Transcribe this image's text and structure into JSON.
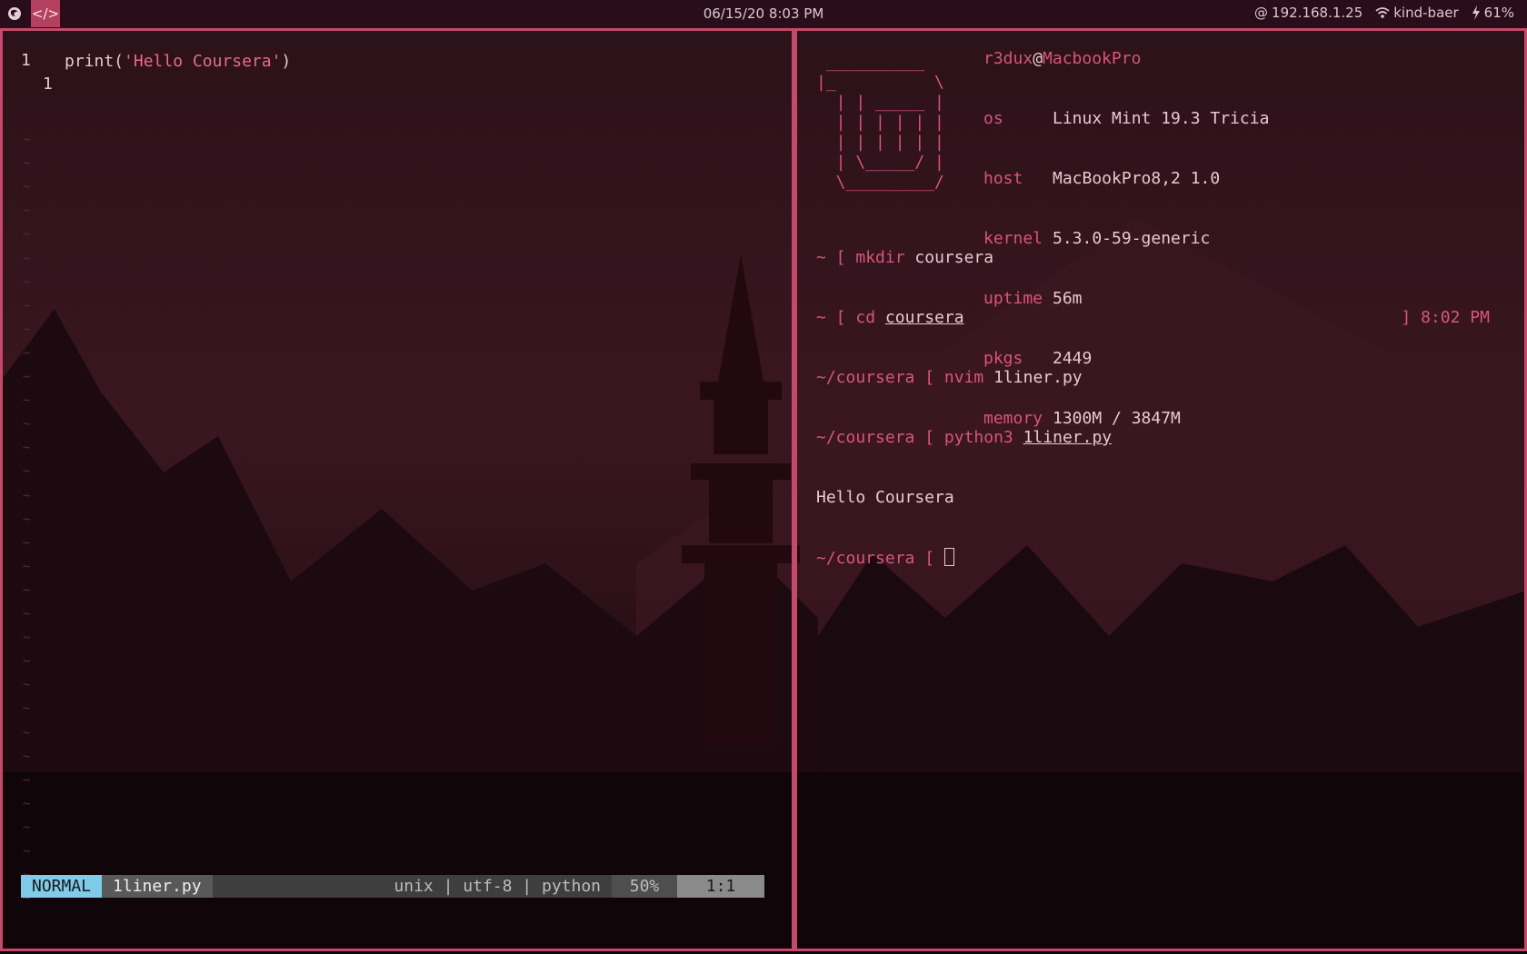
{
  "topbar": {
    "workspace1_icon": "firefox-icon",
    "workspace2_label": "</>",
    "clock": "06/15/20  8:03 PM",
    "ip": "192.168.1.25",
    "wifi": "kind-baer",
    "battery": "61%"
  },
  "editor": {
    "line_number": "1",
    "relative_number": "1",
    "code_fn": "print(",
    "code_str": "'Hello Coursera'",
    "code_end": ")",
    "tilde": "~",
    "status": {
      "mode": "NORMAL",
      "file": "1liner.py",
      "info": "unix | utf-8 | python",
      "percent": "50%",
      "position": "1:1"
    }
  },
  "terminal": {
    "ascii_logo": [
      " __________",
      "|_          \\",
      "  | | _____ |",
      "  | | | | | |",
      "  | | | | | |",
      "  | \\_____/ |",
      "  \\_________/"
    ],
    "user": "r3dux",
    "at": "@",
    "host_name": "MacbookPro",
    "info": [
      {
        "key": "os",
        "value": "Linux Mint 19.3 Tricia"
      },
      {
        "key": "host",
        "value": "MacBookPro8,2 1.0"
      },
      {
        "key": "kernel",
        "value": "5.3.0-59-generic"
      },
      {
        "key": "uptime",
        "value": "56m"
      },
      {
        "key": "pkgs",
        "value": "2449"
      },
      {
        "key": "memory",
        "value": "1300M / 3847M"
      }
    ],
    "lines": [
      {
        "prompt": "~ [ ",
        "cmd": "mkdir",
        "arg": "coursera"
      },
      {
        "prompt": "~ [ ",
        "cmd": "cd",
        "arg": "coursera"
      },
      {
        "prompt": "~/coursera [ ",
        "cmd": "nvim",
        "arg": "1liner.py"
      },
      {
        "prompt": "~/coursera [ ",
        "cmd": "python3",
        "arg": "1liner.py"
      }
    ],
    "output": "Hello Coursera",
    "current_prompt": "~/coursera [ ",
    "right_prompt": "] 8:02 PM"
  },
  "colors": {
    "accent": "#c44a6b",
    "text": "#e7c9d2",
    "pink": "#d8557a"
  }
}
